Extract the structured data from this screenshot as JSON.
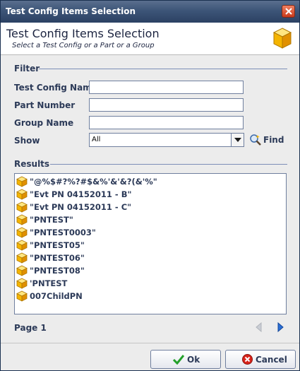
{
  "window": {
    "title": "Test Config Items Selection"
  },
  "header": {
    "title": "Test Config Items Selection",
    "subtitle": "Select a Test Config or a Part or a Group",
    "icon": "cube-icon"
  },
  "filter": {
    "section_label": "Filter",
    "test_config_name": {
      "label": "Test Config Name",
      "value": ""
    },
    "part_number": {
      "label": "Part Number",
      "value": ""
    },
    "group_name": {
      "label": "Group Name",
      "value": ""
    },
    "show": {
      "label": "Show",
      "value": "All"
    },
    "find_label": "Find"
  },
  "results": {
    "section_label": "Results",
    "items": [
      "\"@%$#?%?#$&%'&'&?(&'%\"",
      "\"Evt PN 04152011 - B\"",
      "\"Evt PN 04152011 - C\"",
      "\"PNTEST\"",
      "\"PNTEST0003\"",
      "\"PNTEST05\"",
      "\"PNTEST06\"",
      "\"PNTEST08\"",
      "'PNTEST",
      "007ChildPN"
    ]
  },
  "pagination": {
    "page_label": "Page 1"
  },
  "buttons": {
    "ok_label": "Ok",
    "cancel_label": "Cancel"
  },
  "colors": {
    "titlebar": "#3d5578",
    "label": "#2c3a58",
    "accent": "#2a6fd6"
  }
}
